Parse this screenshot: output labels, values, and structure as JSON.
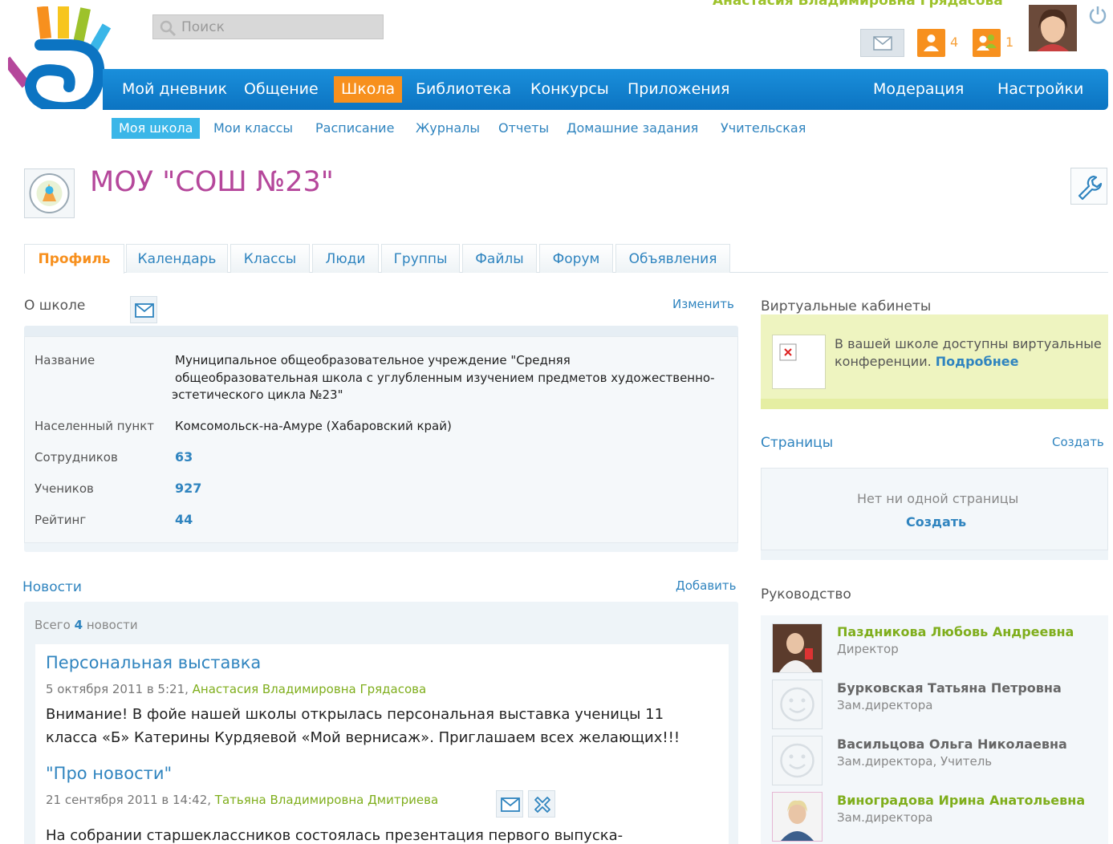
{
  "header": {
    "search_placeholder": "Поиск",
    "user_name": "Анастасия Владимировна Грядасова",
    "friends_count": "4",
    "groups_count": "1"
  },
  "main_nav": {
    "items": [
      "Мой дневник",
      "Общение",
      "Школа",
      "Библиотека",
      "Конкурсы",
      "Приложения"
    ],
    "right_items": [
      "Модерация",
      "Настройки"
    ],
    "active": "Школа"
  },
  "sub_nav": {
    "items": [
      "Моя школа",
      "Мои классы",
      "Расписание",
      "Журналы",
      "Отчеты",
      "Домашние задания",
      "Учительская"
    ],
    "active": "Моя школа"
  },
  "school": {
    "title": "МОУ \"СОШ №23\""
  },
  "tabs": [
    "Профиль",
    "Календарь",
    "Классы",
    "Люди",
    "Группы",
    "Файлы",
    "Форум",
    "Объявления"
  ],
  "about": {
    "title": "О школе",
    "edit_link": "Изменить",
    "name_label": "Название",
    "name_lines": [
      "Муниципальное общеобразовательное учреждение \"Средняя",
      "общеобразовательная школа с углубленным изучением предметов художественно-",
      "эстетического цикла №23\""
    ],
    "city_label": "Населенный пункт",
    "city_value": "Комсомольск-на-Амуре (Хабаровский край)",
    "staff_label": "Сотрудников",
    "staff_value": "63",
    "students_label": "Учеников",
    "students_value": "927",
    "rating_label": "Рейтинг",
    "rating_value": "44"
  },
  "news": {
    "title": "Новости",
    "add_link": "Добавить",
    "total_prefix": "Всего",
    "total_count": "4",
    "total_suffix": "новости",
    "items": [
      {
        "title": "Персональная выставка",
        "date": "5 октября 2011 в 5:21,",
        "author": "Анастасия Владимировна Грядасова",
        "text_lines": [
          "Внимание! В фойе нашей школы открылась персональная выставка ученицы 11",
          "класса «Б» Катерины Курдяевой «Мой вернисаж». Приглашаем всех желающих!!!"
        ]
      },
      {
        "title": "\"Про новости\"",
        "date": "21 сентября 2011 в 14:42,",
        "author": "Татьяна Владимировна Дмитриева",
        "text_lines": [
          "На собрании старшеклассников состоялась презентация первого выпуска-"
        ]
      }
    ]
  },
  "virtual_rooms": {
    "title": "Виртуальные кабинеты",
    "text_line1": "В вашей школе доступны виртуальные",
    "text_line2": "конференции.",
    "more_link": "Подробнее"
  },
  "pages": {
    "title": "Страницы",
    "create_link": "Создать",
    "empty_text": "Нет ни одной страницы",
    "create_button": "Создать"
  },
  "leadership": {
    "title": "Руководство",
    "people": [
      {
        "name": "Паздникова Любовь Андреевна",
        "role": "Директор"
      },
      {
        "name": "Бурковская Татьяна Петровна",
        "role": "Зам.директора"
      },
      {
        "name": "Васильцова Ольга Николаевна",
        "role": "Зам.директора, Учитель"
      },
      {
        "name": "Виноградова Ирина Анатольевна",
        "role": "Зам.директора"
      }
    ]
  },
  "colors": {
    "nav_blue": "#1a8fdb",
    "accent_orange": "#f7901e",
    "title_purple": "#b5479b",
    "link_blue": "#2f84bf",
    "green": "#7fae1c"
  }
}
